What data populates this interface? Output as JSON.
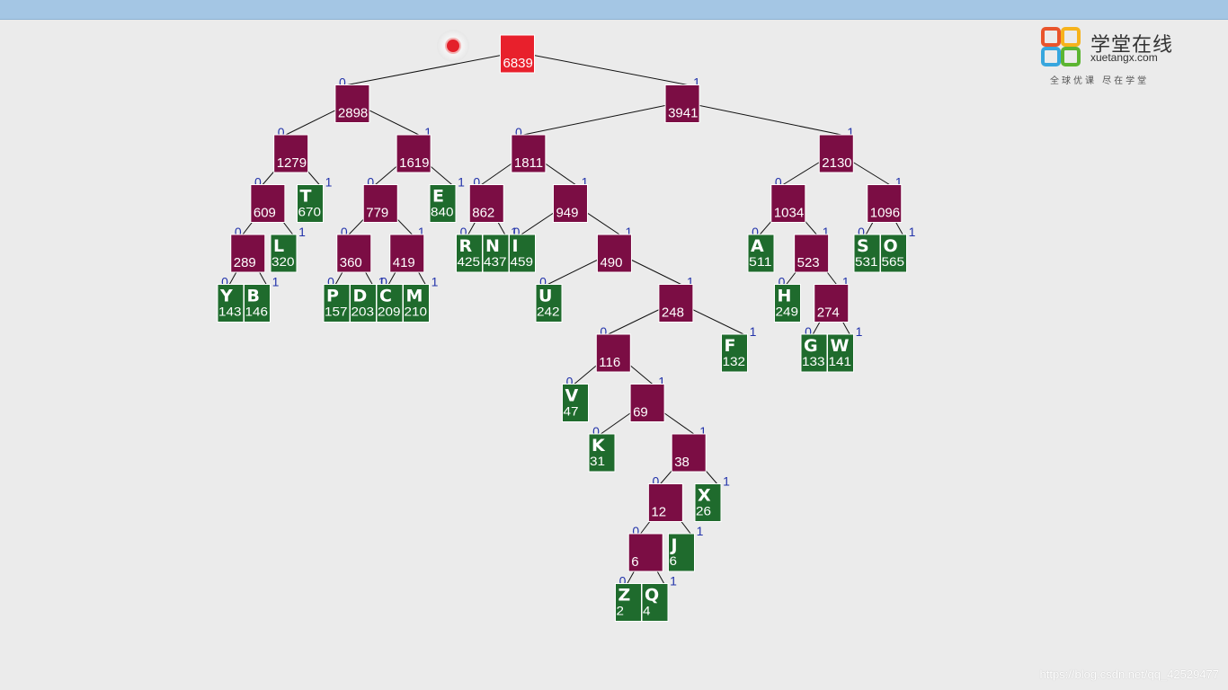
{
  "logo": {
    "title": "学堂在线",
    "domain": "xuetangx.com",
    "slogan": "全球优课 尽在学堂",
    "colors": [
      "#e9542b",
      "#37a6de",
      "#f6b31c",
      "#5cb531"
    ]
  },
  "recorder_icon": "record-icon",
  "watermark": "https://blog.csdn.net/qq_42529477",
  "colors": {
    "root": "#e8202c",
    "internal": "#7b0d44",
    "leaf": "#1f6b2d",
    "bit": "#2233aa",
    "edge": "#111111"
  },
  "tree": {
    "weight": "6839",
    "root": true,
    "children": [
      {
        "weight": "2898",
        "children": [
          {
            "weight": "1279",
            "children": [
              {
                "weight": "609",
                "children": [
                  {
                    "weight": "289",
                    "children": [
                      {
                        "char": "Y",
                        "weight": "143"
                      },
                      {
                        "char": "B",
                        "weight": "146"
                      }
                    ]
                  },
                  {
                    "char": "L",
                    "weight": "320"
                  }
                ]
              },
              {
                "char": "T",
                "weight": "670"
              }
            ]
          },
          {
            "weight": "1619",
            "children": [
              {
                "weight": "779",
                "children": [
                  {
                    "weight": "360",
                    "children": [
                      {
                        "char": "P",
                        "weight": "157"
                      },
                      {
                        "char": "D",
                        "weight": "203"
                      }
                    ]
                  },
                  {
                    "weight": "419",
                    "children": [
                      {
                        "char": "C",
                        "weight": "209"
                      },
                      {
                        "char": "M",
                        "weight": "210"
                      }
                    ]
                  }
                ]
              },
              {
                "char": "E",
                "weight": "840"
              }
            ]
          }
        ]
      },
      {
        "weight": "3941",
        "children": [
          {
            "weight": "1811",
            "children": [
              {
                "weight": "862",
                "children": [
                  {
                    "char": "R",
                    "weight": "425"
                  },
                  {
                    "char": "N",
                    "weight": "437"
                  }
                ]
              },
              {
                "weight": "949",
                "children": [
                  {
                    "char": "I",
                    "weight": "459"
                  },
                  {
                    "weight": "490",
                    "children": [
                      {
                        "char": "U",
                        "weight": "242"
                      },
                      {
                        "weight": "248",
                        "children": [
                          {
                            "weight": "116",
                            "children": [
                              {
                                "char": "V",
                                "weight": "47"
                              },
                              {
                                "weight": "69",
                                "children": [
                                  {
                                    "char": "K",
                                    "weight": "31"
                                  },
                                  {
                                    "weight": "38",
                                    "children": [
                                      {
                                        "weight": "12",
                                        "children": [
                                          {
                                            "weight": "6",
                                            "children": [
                                              {
                                                "char": "Z",
                                                "weight": "2"
                                              },
                                              {
                                                "char": "Q",
                                                "weight": "4"
                                              }
                                            ]
                                          },
                                          {
                                            "char": "J",
                                            "weight": "6"
                                          }
                                        ]
                                      },
                                      {
                                        "char": "X",
                                        "weight": "26"
                                      }
                                    ]
                                  }
                                ]
                              }
                            ]
                          },
                          {
                            "char": "F",
                            "weight": "132"
                          }
                        ]
                      }
                    ]
                  }
                ]
              }
            ]
          },
          {
            "weight": "2130",
            "children": [
              {
                "weight": "1034",
                "children": [
                  {
                    "char": "A",
                    "weight": "511"
                  },
                  {
                    "weight": "523",
                    "children": [
                      {
                        "char": "H",
                        "weight": "249"
                      },
                      {
                        "weight": "274",
                        "children": [
                          {
                            "char": "G",
                            "weight": "133"
                          },
                          {
                            "char": "W",
                            "weight": "141"
                          }
                        ]
                      }
                    ]
                  }
                ]
              },
              {
                "weight": "1096",
                "children": [
                  {
                    "char": "S",
                    "weight": "531"
                  },
                  {
                    "char": "O",
                    "weight": "565"
                  }
                ]
              }
            ]
          }
        ]
      }
    ]
  }
}
